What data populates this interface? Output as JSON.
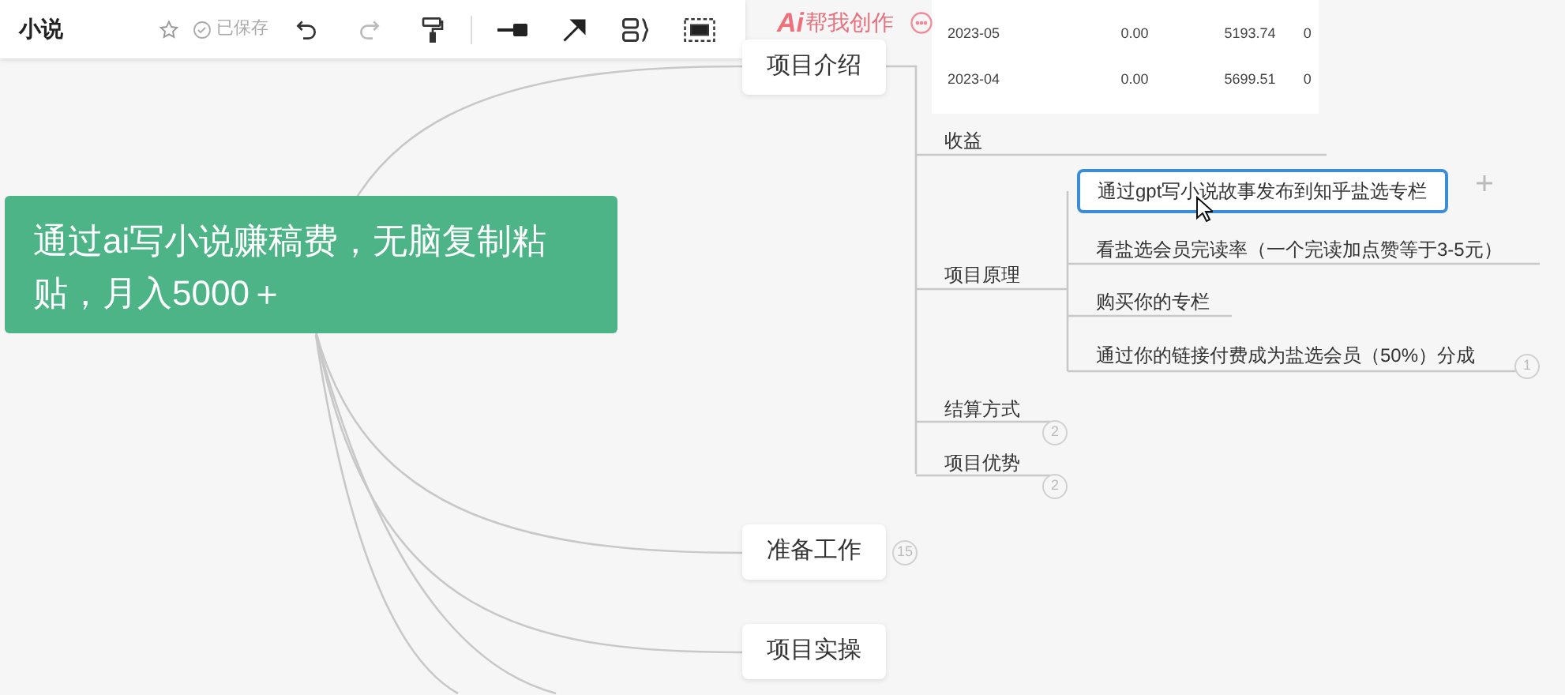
{
  "document_title": "小说",
  "save_status": "已保存",
  "ai_assistant": {
    "badge": "Ai",
    "label": "帮我创作"
  },
  "embedded_table": {
    "rows": [
      {
        "month": "2023-05",
        "column_3": "0.00",
        "column_4": "5193.74",
        "column_5": "0"
      },
      {
        "month": "2023-04",
        "column_3": "0.00",
        "column_4": "5699.51",
        "column_5": "0"
      }
    ]
  },
  "root": {
    "text": "通过ai写小说赚稿费，无脑复制粘贴，月入5000＋"
  },
  "branches": [
    {
      "text": "项目介绍",
      "children": [
        {
          "text": "收益"
        },
        {
          "text": "项目原理",
          "children": [
            {
              "text": "通过gpt写小说故事发布到知乎盐选专栏",
              "selected": true
            },
            {
              "text": "看盐选会员完读率（一个完读加点赞等于3-5元）",
              "selected": false
            },
            {
              "text": "购买你的专栏",
              "selected": false
            },
            {
              "text": "通过你的链接付费成为盐选会员（50%）分成",
              "selected": false,
              "collapsed_count": "1"
            }
          ]
        },
        {
          "text": "结算方式",
          "collapsed_count": "2"
        },
        {
          "text": "项目优势",
          "collapsed_count": "2"
        }
      ]
    },
    {
      "text": "准备工作",
      "collapsed_count": "15"
    },
    {
      "text": "项目实操"
    }
  ]
}
